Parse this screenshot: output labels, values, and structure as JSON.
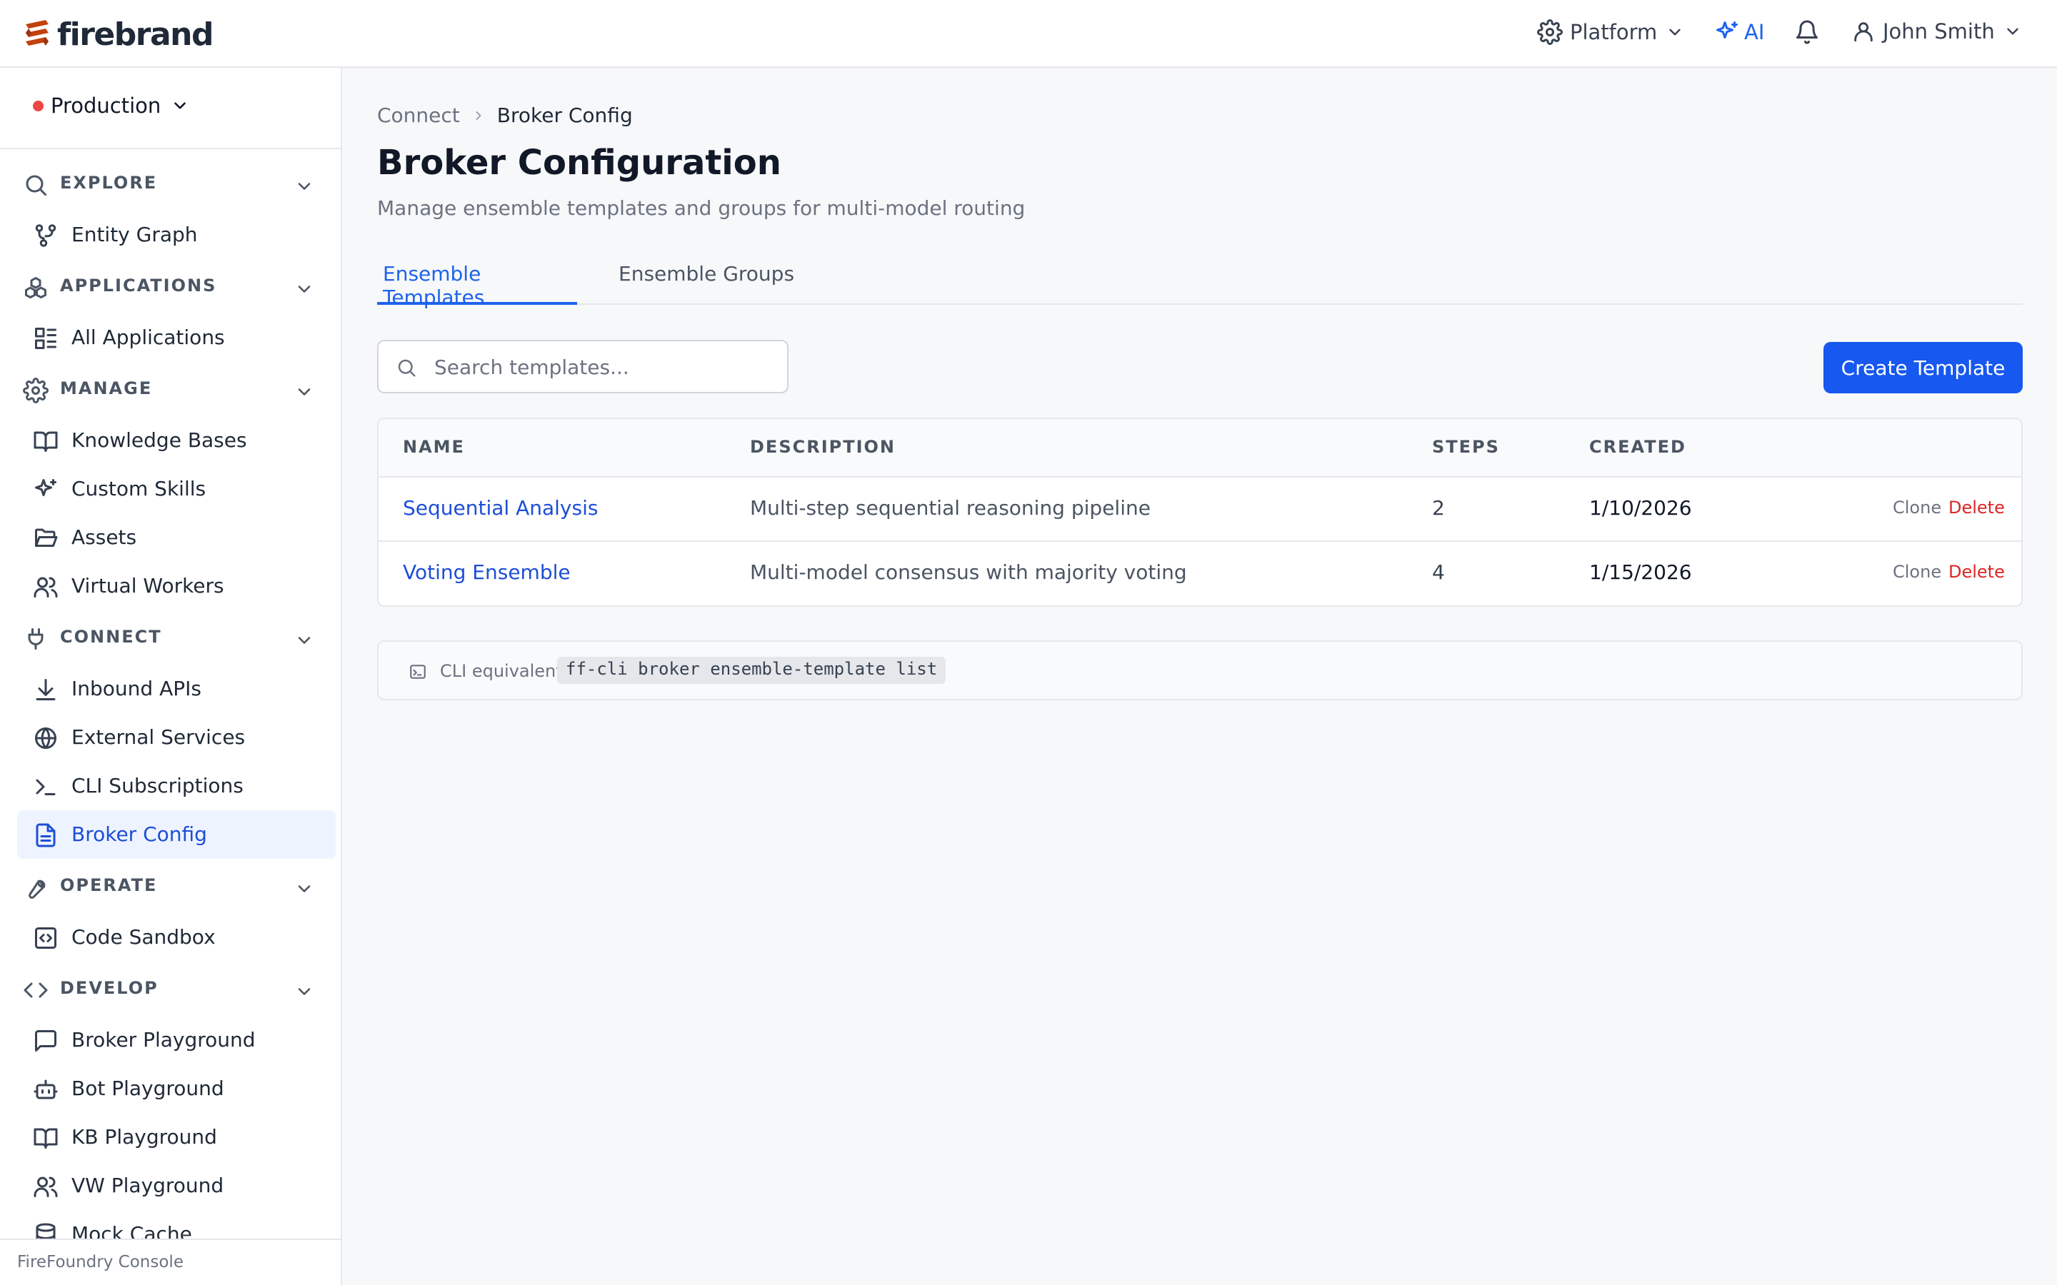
{
  "app": {
    "brand": "firebrand",
    "brand_color": "#c2410c",
    "accent": "#1d63ed"
  },
  "topbar": {
    "platform_label": "Platform",
    "ai_label": "AI",
    "user_name": "John Smith"
  },
  "sidebar": {
    "environment": "Production",
    "environment_status_color": "#ef4444",
    "sections": {
      "explore": "EXPLORE",
      "applications": "APPLICATIONS",
      "manage": "MANAGE",
      "connect": "CONNECT",
      "operate": "OPERATE",
      "develop": "DEVELOP"
    },
    "items": {
      "entity_graph": "Entity Graph",
      "all_applications": "All Applications",
      "knowledge_bases": "Knowledge Bases",
      "custom_skills": "Custom Skills",
      "assets": "Assets",
      "virtual_workers": "Virtual Workers",
      "inbound_apis": "Inbound APIs",
      "external_services": "External Services",
      "cli_subscriptions": "CLI Subscriptions",
      "broker_config": "Broker Config",
      "code_sandbox": "Code Sandbox",
      "broker_playground": "Broker Playground",
      "bot_playground": "Bot Playground",
      "kb_playground": "KB Playground",
      "vw_playground": "VW Playground",
      "mock_cache": "Mock Cache"
    },
    "active_item": "Broker Config",
    "footer": "FireFoundry Console"
  },
  "breadcrumb": {
    "parent": "Connect",
    "current": "Broker Config"
  },
  "page": {
    "title": "Broker Configuration",
    "subtitle": "Manage ensemble templates and groups for multi-model routing"
  },
  "tabs": {
    "templates": "Ensemble Templates",
    "groups": "Ensemble Groups",
    "active": "Ensemble Templates"
  },
  "search": {
    "placeholder": "Search templates...",
    "value": ""
  },
  "create_button": "Create Template",
  "table": {
    "columns": {
      "name": "NAME",
      "description": "DESCRIPTION",
      "steps": "STEPS",
      "created": "CREATED"
    },
    "rows": [
      {
        "name": "Sequential Analysis",
        "description": "Multi-step sequential reasoning pipeline",
        "steps": "2",
        "created": "1/10/2026",
        "clone": "Clone",
        "delete": "Delete"
      },
      {
        "name": "Voting Ensemble",
        "description": "Multi-model consensus with majority voting",
        "steps": "4",
        "created": "1/15/2026",
        "clone": "Clone",
        "delete": "Delete"
      }
    ]
  },
  "cli": {
    "label": "CLI equivalent:",
    "command": "ff-cli broker ensemble-template list"
  }
}
